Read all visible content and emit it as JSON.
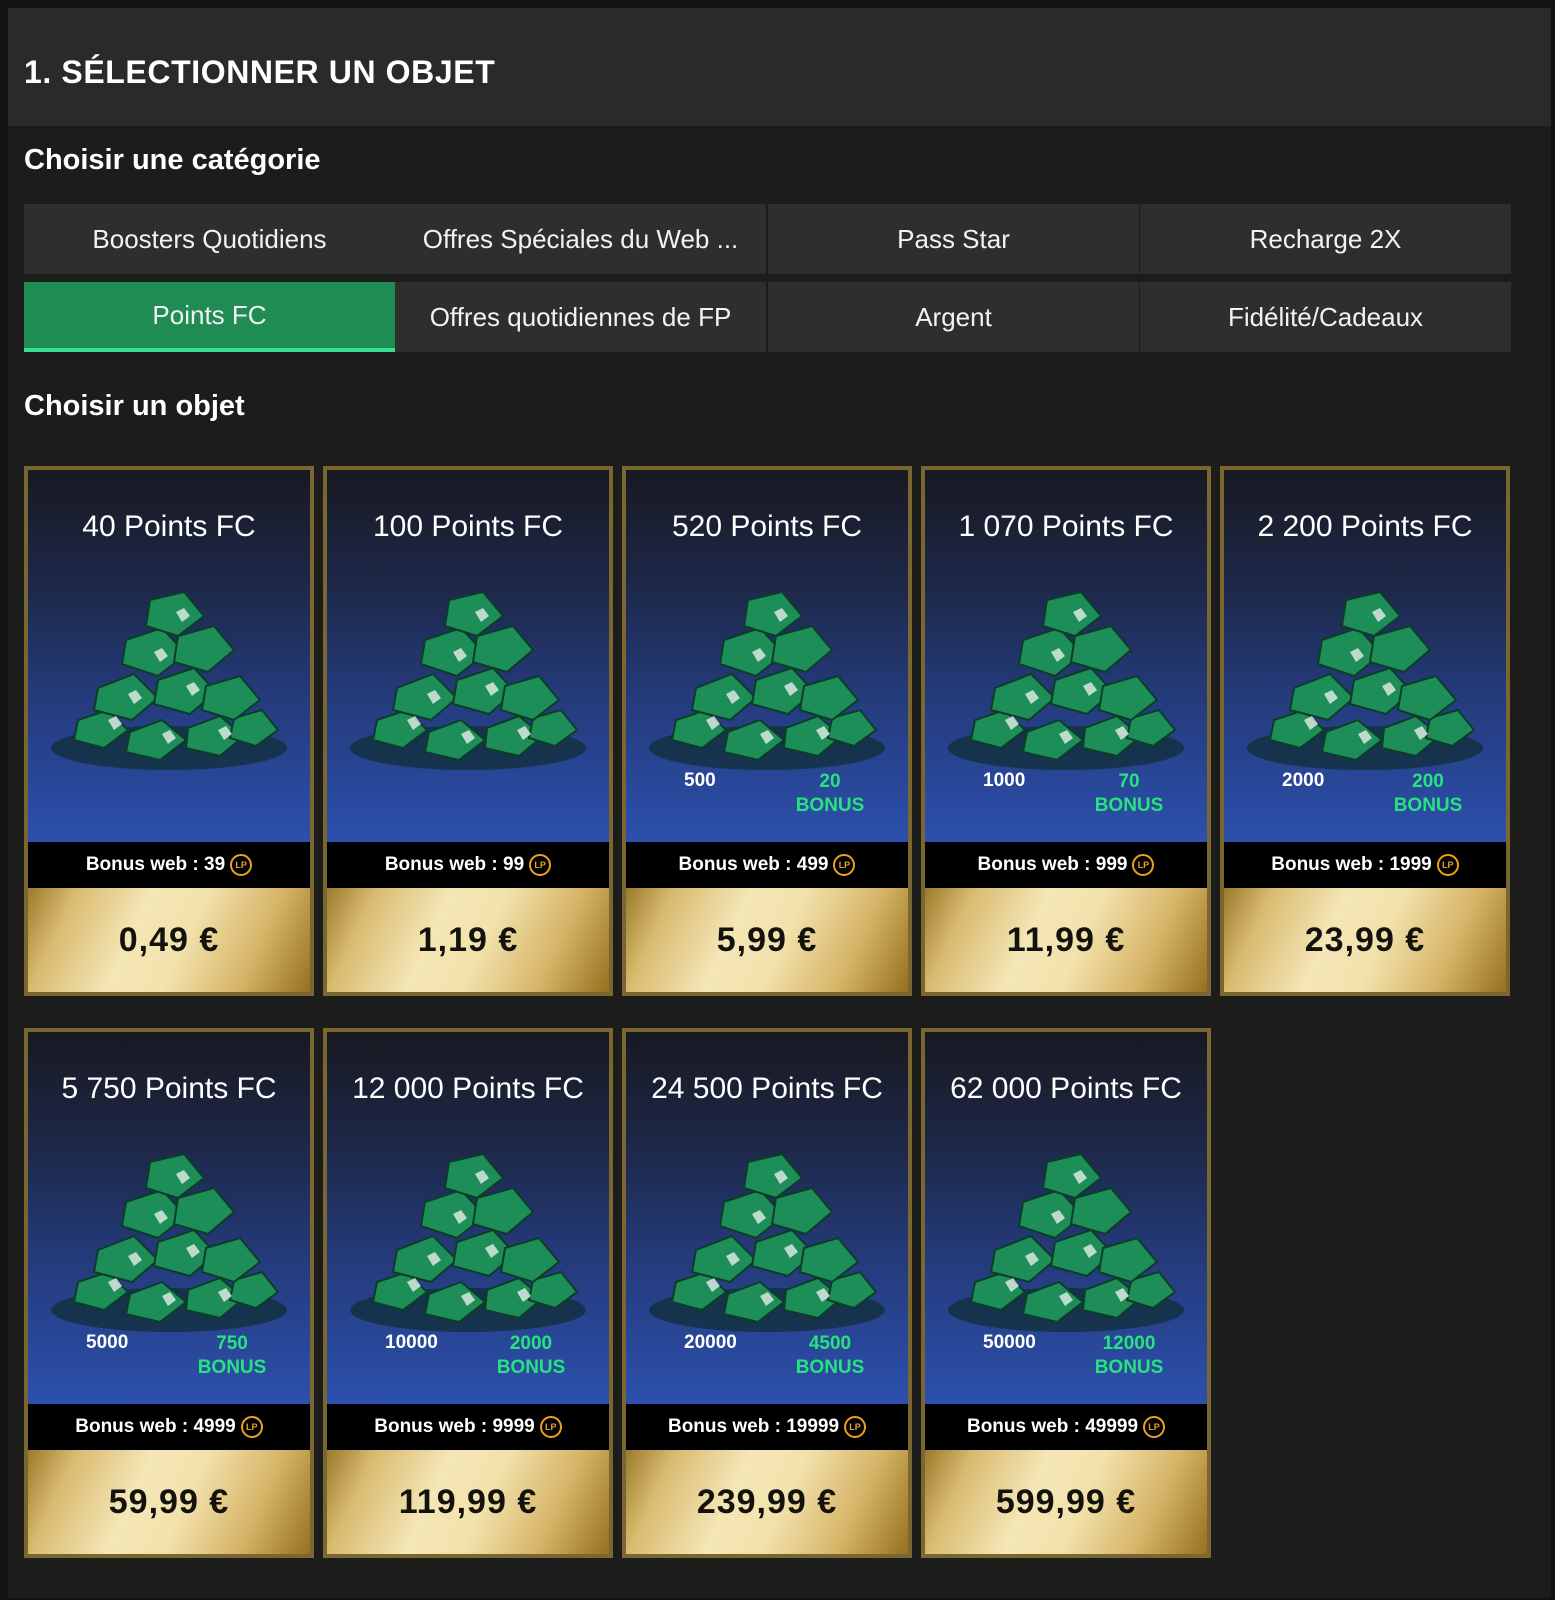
{
  "step": {
    "title": "1. SÉLECTIONNER UN OBJET"
  },
  "categories": {
    "label": "Choisir une catégorie",
    "items": [
      {
        "label": "Boosters Quotidiens",
        "active": false
      },
      {
        "label": "Offres Spéciales du Web ...",
        "active": false
      },
      {
        "label": "Pass Star",
        "active": false
      },
      {
        "label": "Recharge 2X",
        "active": false
      },
      {
        "label": "Points FC",
        "active": true
      },
      {
        "label": "Offres quotidiennes de FP",
        "active": false
      },
      {
        "label": "Argent",
        "active": false
      },
      {
        "label": "Fidélité/Cadeaux",
        "active": false
      }
    ]
  },
  "products": {
    "label": "Choisir un objet",
    "currency_icon": "lp-coin-icon",
    "currency_icon_text": "LP",
    "items": [
      {
        "title": "40 Points FC",
        "bonus_web": "Bonus web : 39",
        "price": "0,49 €",
        "base": "",
        "bonus": "",
        "bonus_label": ""
      },
      {
        "title": "100 Points FC",
        "bonus_web": "Bonus web : 99",
        "price": "1,19 €",
        "base": "",
        "bonus": "",
        "bonus_label": ""
      },
      {
        "title": "520 Points FC",
        "bonus_web": "Bonus web : 499",
        "price": "5,99 €",
        "base": "500",
        "bonus": "20",
        "bonus_label": "BONUS"
      },
      {
        "title": "1 070 Points FC",
        "bonus_web": "Bonus web : 999",
        "price": "11,99 €",
        "base": "1000",
        "bonus": "70",
        "bonus_label": "BONUS"
      },
      {
        "title": "2 200 Points FC",
        "bonus_web": "Bonus web : 1999",
        "price": "23,99 €",
        "base": "2000",
        "bonus": "200",
        "bonus_label": "BONUS"
      },
      {
        "title": "5 750 Points FC",
        "bonus_web": "Bonus web : 4999",
        "price": "59,99 €",
        "base": "5000",
        "bonus": "750",
        "bonus_label": "BONUS"
      },
      {
        "title": "12 000 Points FC",
        "bonus_web": "Bonus web : 9999",
        "price": "119,99 €",
        "base": "10000",
        "bonus": "2000",
        "bonus_label": "BONUS"
      },
      {
        "title": "24 500 Points FC",
        "bonus_web": "Bonus web : 19999",
        "price": "239,99 €",
        "base": "20000",
        "bonus": "4500",
        "bonus_label": "BONUS"
      },
      {
        "title": "62 000 Points FC",
        "bonus_web": "Bonus web : 49999",
        "price": "599,99 €",
        "base": "50000",
        "bonus": "12000",
        "bonus_label": "BONUS"
      }
    ]
  },
  "colors": {
    "accent_active": "#1f8c54",
    "active_underline": "#38e08c",
    "bonus_green": "#27e37e",
    "card_border_gold": "#7a6630",
    "lp_coin": "#e9a21c"
  }
}
